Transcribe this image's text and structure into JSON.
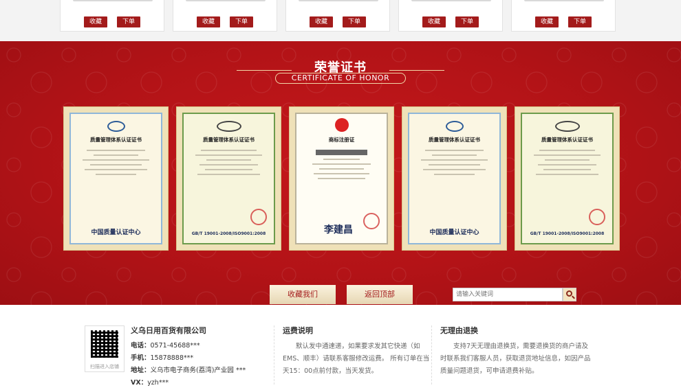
{
  "products": [
    {
      "favorite_label": "收藏",
      "order_label": "下单"
    },
    {
      "favorite_label": "收藏",
      "order_label": "下单"
    },
    {
      "favorite_label": "收藏",
      "order_label": "下单"
    },
    {
      "favorite_label": "收藏",
      "order_label": "下单"
    },
    {
      "favorite_label": "收藏",
      "order_label": "下单"
    }
  ],
  "honor": {
    "title_cn": "荣誉证书",
    "title_en": "CERTIFICATE OF HONOR",
    "certificates": [
      {
        "title": "质量管理体系认证证书",
        "standard": "中国质量认证中心"
      },
      {
        "title": "质量管理体系认证证书",
        "standard": "GB/T 19001-2008/ISO9001:2008"
      },
      {
        "title": "商标注册证",
        "standard": "李建昌"
      },
      {
        "title": "质量管理体系认证证书",
        "standard": "中国质量认证中心"
      },
      {
        "title": "质量管理体系认证证书",
        "standard": "GB/T 19001-2008/ISO9001:2008"
      }
    ],
    "favorite_button": "收藏我们",
    "back_top_button": "返回顶部",
    "search_placeholder": "请输入关键词"
  },
  "footer": {
    "company": {
      "name": "义乌日用百货有限公司",
      "phone_label": "电话：",
      "phone": "0571-45688***",
      "mobile_label": "手机：",
      "mobile": "15878888***",
      "address_label": "地址：",
      "address": "义乌市电子商务(荔湾)产业园 ***",
      "vx_label": "VX：",
      "vx": "yzh***",
      "qr_label": "扫描进入店铺"
    },
    "shipping": {
      "title": "运费说明",
      "text": "默认发中通速递，如果要求发其它快递（如EMS、顺丰）请联系客服修改运费。 所有订单在当天15：00点前付款，当天发货。"
    },
    "returns": {
      "title": "无理由退换",
      "text": "支持7天无理由退换货，需要退换货的商户请及时联系我们客服人员，获取退货地址信息，如因产品质量问题退货，可申请退费补贴。"
    }
  },
  "colors": {
    "brand_red": "#a31b1b",
    "band_red": "#b31317",
    "gold": "#f2d7a8"
  }
}
